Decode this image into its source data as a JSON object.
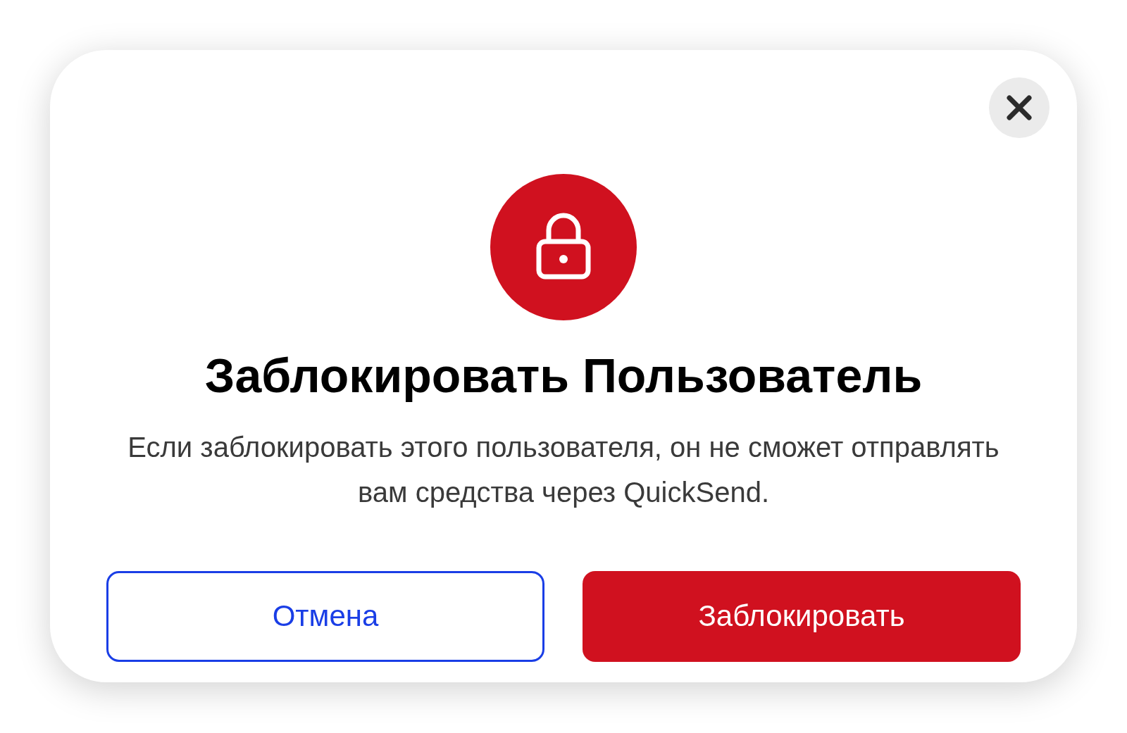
{
  "dialog": {
    "title": "Заблокировать Пользователь",
    "message": "Если заблокировать этого пользователя, он не сможет отправлять вам средства через QuickSend.",
    "buttons": [
      {
        "label": "Отмена",
        "kind": "secondary"
      },
      {
        "label": "Заблокировать",
        "kind": "danger"
      }
    ]
  }
}
